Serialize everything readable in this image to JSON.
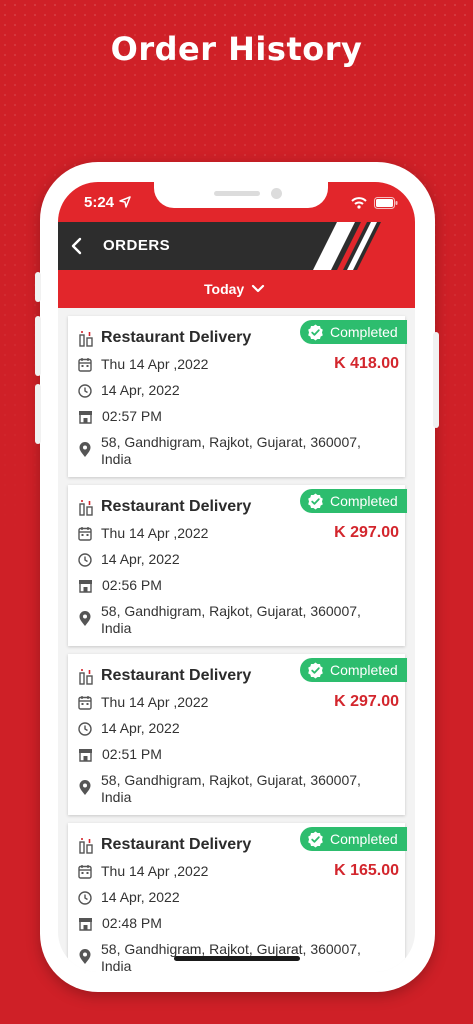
{
  "hero": {
    "title": "Order History"
  },
  "status_bar": {
    "time": "5:24"
  },
  "app_bar": {
    "title": "ORDERS"
  },
  "filter": {
    "selected": "Today"
  },
  "orders": [
    {
      "service": "Restaurant Delivery",
      "status": "Completed",
      "date": "Thu 14 Apr ,2022",
      "price": "K 418.00",
      "day": "14 Apr, 2022",
      "time": "02:57 PM",
      "address": "58, Gandhigram, Rajkot, Gujarat, 360007, India"
    },
    {
      "service": "Restaurant Delivery",
      "status": "Completed",
      "date": "Thu 14 Apr ,2022",
      "price": "K 297.00",
      "day": "14 Apr, 2022",
      "time": "02:56 PM",
      "address": "58, Gandhigram, Rajkot, Gujarat, 360007, India"
    },
    {
      "service": "Restaurant Delivery",
      "status": "Completed",
      "date": "Thu 14 Apr ,2022",
      "price": "K 297.00",
      "day": "14 Apr, 2022",
      "time": "02:51 PM",
      "address": "58, Gandhigram, Rajkot, Gujarat, 360007, India"
    },
    {
      "service": "Restaurant Delivery",
      "status": "Completed",
      "date": "Thu 14 Apr ,2022",
      "price": "K 165.00",
      "day": "14 Apr, 2022",
      "time": "02:48 PM",
      "address": "58, Gandhigram, Rajkot, Gujarat, 360007, India"
    }
  ],
  "colors": {
    "brand_red": "#e2262b",
    "background_red": "#cf2027",
    "completed_green": "#2dbd6e",
    "price_red": "#d3262d",
    "app_bar_dark": "#2d2d2d"
  },
  "icons": {
    "service": "restaurant-icon",
    "date": "calendar-icon",
    "day": "clock-icon",
    "time": "store-icon",
    "address": "location-pin-icon",
    "status": "check-badge-icon"
  }
}
